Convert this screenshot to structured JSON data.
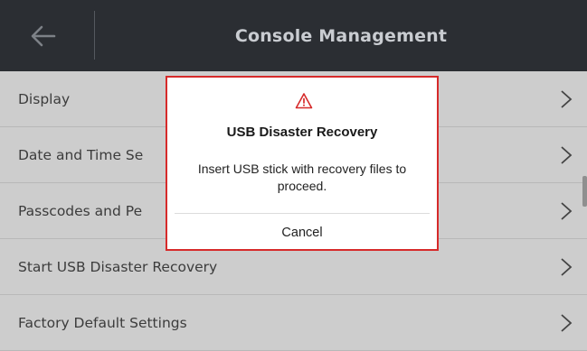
{
  "header": {
    "title": "Console Management",
    "back_icon": "arrow-left-icon"
  },
  "list": {
    "items": [
      {
        "label": "Display",
        "icon": "chevron-right-icon"
      },
      {
        "label": "Date and Time Se",
        "icon": "chevron-right-icon"
      },
      {
        "label": "Passcodes and Pe",
        "icon": "chevron-right-icon"
      },
      {
        "label": "Start USB Disaster Recovery",
        "icon": "chevron-right-icon"
      },
      {
        "label": "Factory Default Settings",
        "icon": "chevron-right-icon"
      }
    ]
  },
  "modal": {
    "icon": "warning-icon",
    "title": "USB Disaster Recovery",
    "message": "Insert USB stick with recovery files to proceed.",
    "cancel_label": "Cancel",
    "accent_color": "#d62a2a"
  },
  "colors": {
    "header_bg": "#2b2e33",
    "list_bg": "#cdcdcd"
  }
}
